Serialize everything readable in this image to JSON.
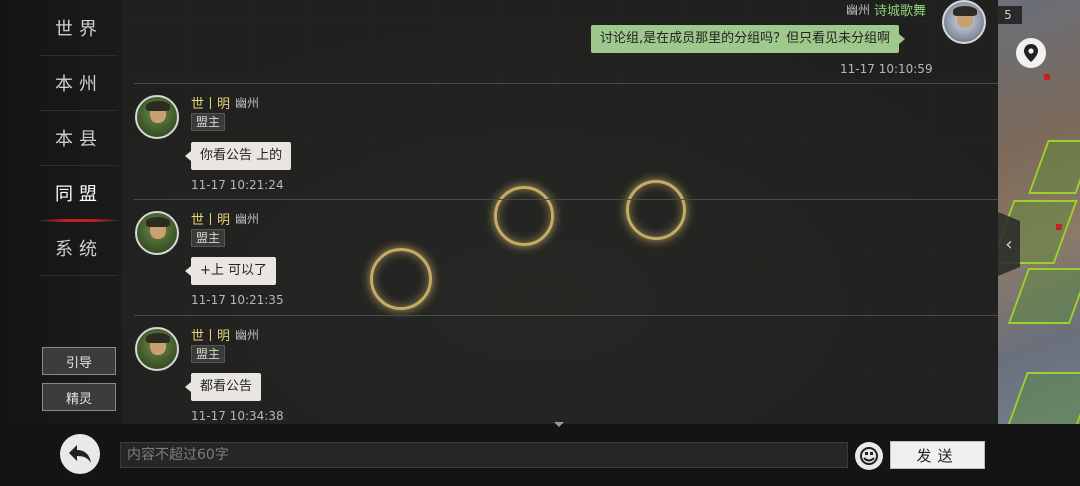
{
  "channels": [
    {
      "label": "世界"
    },
    {
      "label": "本州"
    },
    {
      "label": "本县"
    },
    {
      "label": "同盟",
      "active": true
    },
    {
      "label": "系统"
    }
  ],
  "side_buttons": {
    "guide": "引导",
    "sprite": "精灵"
  },
  "top_counter": "5",
  "my_message": {
    "region": "幽州",
    "name": "诗城歌舞",
    "text": "讨论组,是在成员那里的分组吗？但只看见未分组啊",
    "time": "11-17 10:10:59"
  },
  "messages": [
    {
      "name": "世丨明",
      "region": "幽州",
      "role": "盟主",
      "text": "你看公告 上的",
      "time": "11-17 10:21:24"
    },
    {
      "name": "世丨明",
      "region": "幽州",
      "role": "盟主",
      "text": "+上 可以了",
      "time": "11-17 10:21:35"
    },
    {
      "name": "世丨明",
      "region": "幽州",
      "role": "盟主",
      "text": "都看公告",
      "time": "11-17 10:34:38"
    }
  ],
  "input": {
    "placeholder": "内容不超过60字",
    "value": ""
  },
  "send_label": "发送",
  "icons": {
    "back": "back-arrow-icon",
    "emoji": "emoji-icon",
    "collapse": "chevron-left-icon",
    "location": "location-pin-icon"
  },
  "colors": {
    "accent_red": "#c0201a",
    "name_gold": "#e8d27a",
    "my_name_green": "#8fd07a",
    "my_bubble": "#9fc98c",
    "bubble": "#e9e6df"
  }
}
